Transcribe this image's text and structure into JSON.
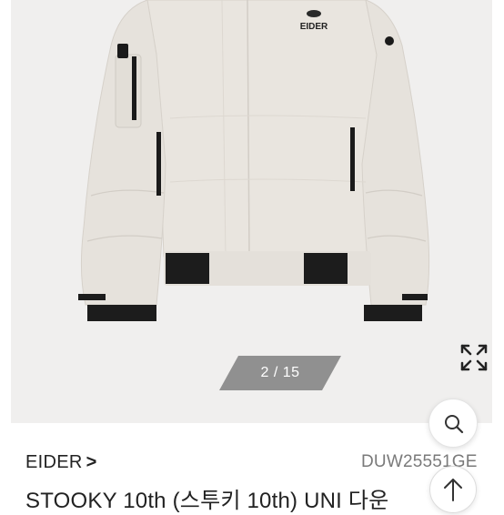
{
  "gallery": {
    "image_alt": "EIDER STOOKY 10th bomber down jacket, light beige",
    "logo_text": "EIDER",
    "counter": "2 / 15",
    "expand_icon": "expand-arrows-icon",
    "search_icon": "search-icon"
  },
  "product": {
    "brand": "EIDER",
    "brand_chevron": ">",
    "sku": "DUW25551GE",
    "title": "STOOKY 10th (스투키 10th) UNI 다운"
  },
  "scroll_top_icon": "arrow-up-icon",
  "colors": {
    "background": "#ffffff",
    "gallery_bg": "#f0efee",
    "jacket": "#e9e5df",
    "text_primary": "#222222",
    "text_secondary": "#7a7a7a"
  }
}
